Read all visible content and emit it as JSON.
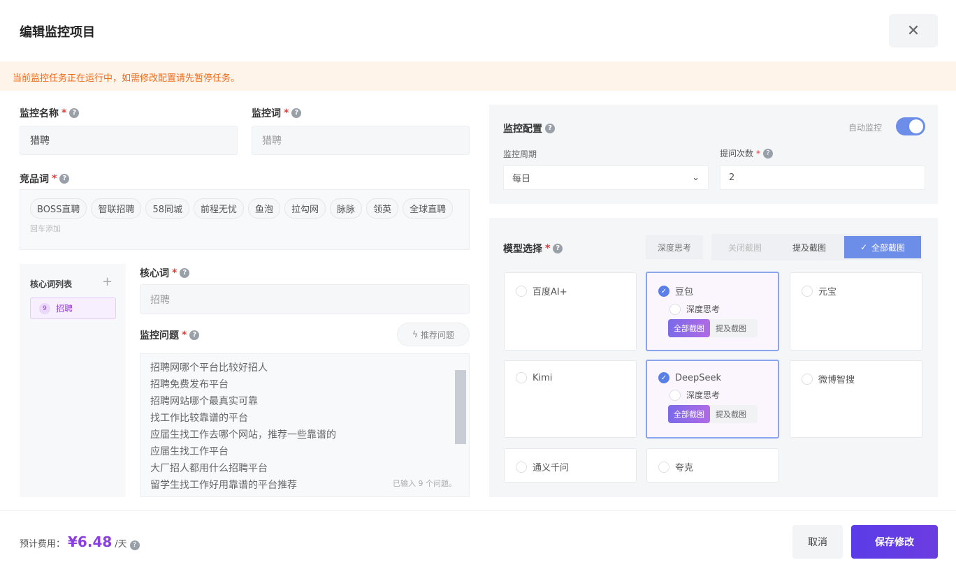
{
  "dialog": {
    "title": "编辑监控项目",
    "warning": "当前监控任务正在运行中，如需修改配置请先暂停任务。"
  },
  "form": {
    "name_label": "监控名称",
    "name_value": "猎聘",
    "word_label": "监控词",
    "word_placeholder": "猎聘",
    "competitor_label": "竞品词",
    "competitors": [
      "BOSS直聘",
      "智联招聘",
      "58同城",
      "前程无忧",
      "鱼泡",
      "拉勾网",
      "脉脉",
      "领英",
      "全球直聘"
    ],
    "competitor_hint": "回车添加",
    "core_list_label": "核心词列表",
    "core_items": [
      {
        "count": "9",
        "label": "招聘"
      }
    ],
    "core_label": "核心词",
    "core_placeholder": "招聘",
    "questions_label": "监控问题",
    "recommend_label": "推荐问题",
    "questions": [
      "招聘网哪个平台比较好招人",
      "招聘免费发布平台",
      "招聘网站哪个最真实可靠",
      "找工作比较靠谱的平台",
      "应届生找工作去哪个网站，推荐一些靠谱的",
      "应届生找工作平台",
      "大厂招人都用什么招聘平台",
      "留学生找工作好用靠谱的平台推荐"
    ],
    "questions_count": "已输入 9 个问题。"
  },
  "config": {
    "title": "监控配置",
    "auto_label": "自动监控",
    "auto_on": true,
    "period_label": "监控周期",
    "period_value": "每日",
    "times_label": "提问次数",
    "times_value": "2"
  },
  "models": {
    "title": "模型选择",
    "deep_think": "深度思考",
    "modes": [
      "关闭截图",
      "提及截图",
      "全部截图"
    ],
    "active_mode": "全部截图",
    "items": [
      {
        "name": "百度AI+",
        "checked": false
      },
      {
        "name": "豆包",
        "checked": true,
        "sub": "深度思考",
        "b1": "全部截图",
        "b2": "提及截图"
      },
      {
        "name": "元宝",
        "checked": false
      },
      {
        "name": "Kimi",
        "checked": false
      },
      {
        "name": "DeepSeek",
        "checked": true,
        "sub": "深度思考",
        "b1": "全部截图",
        "b2": "提及截图"
      },
      {
        "name": "微博智搜",
        "checked": false
      },
      {
        "name": "通义千问",
        "checked": false
      },
      {
        "name": "夸克",
        "checked": false
      }
    ]
  },
  "footer": {
    "cost_label": "预计费用：",
    "cost_value": "¥6.48",
    "cost_unit": "/天",
    "cancel": "取消",
    "save": "保存修改"
  }
}
